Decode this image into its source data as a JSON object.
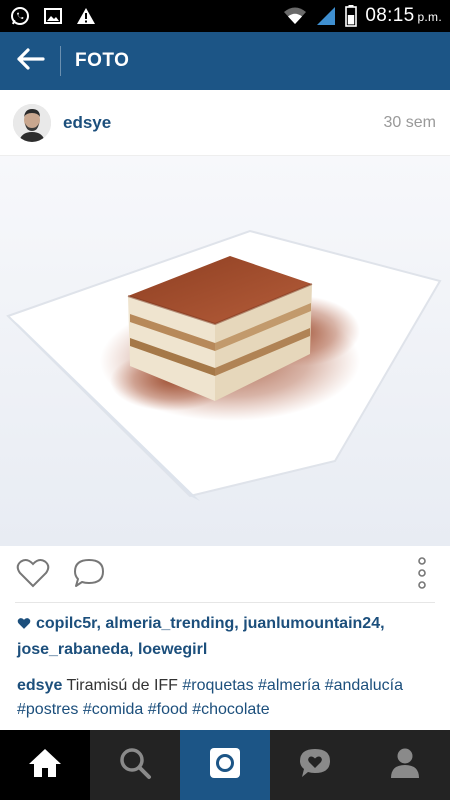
{
  "status_bar": {
    "time": "08:15",
    "time_suffix": "p.m.",
    "icons": [
      "whatsapp-icon",
      "image-icon",
      "warning-icon",
      "wifi-icon",
      "signal-icon",
      "battery-icon"
    ]
  },
  "app_bar": {
    "title": "FOTO",
    "back_icon": "arrow-left-icon",
    "color": "#1c5586"
  },
  "post": {
    "username": "edsye",
    "time_ago": "30 sem",
    "likes_users": "copilc5r, almeria_trending, juanlumountain24, jose_rabaneda, loewegirl",
    "caption_user": "edsye",
    "caption_text": "Tiramisú de IFF",
    "caption_tags": "#roquetas #almería #andalucía #postres #comida #food #chocolate"
  },
  "actions": {
    "icons": [
      "heart-outline-icon",
      "comment-bubble-icon",
      "more-vertical-icon"
    ]
  },
  "bottom_nav": {
    "items": [
      "home-icon",
      "search-icon",
      "camera-icon",
      "activity-icon",
      "profile-icon"
    ]
  },
  "colors": {
    "accent": "#1c5586",
    "link": "#1c4f7c"
  }
}
